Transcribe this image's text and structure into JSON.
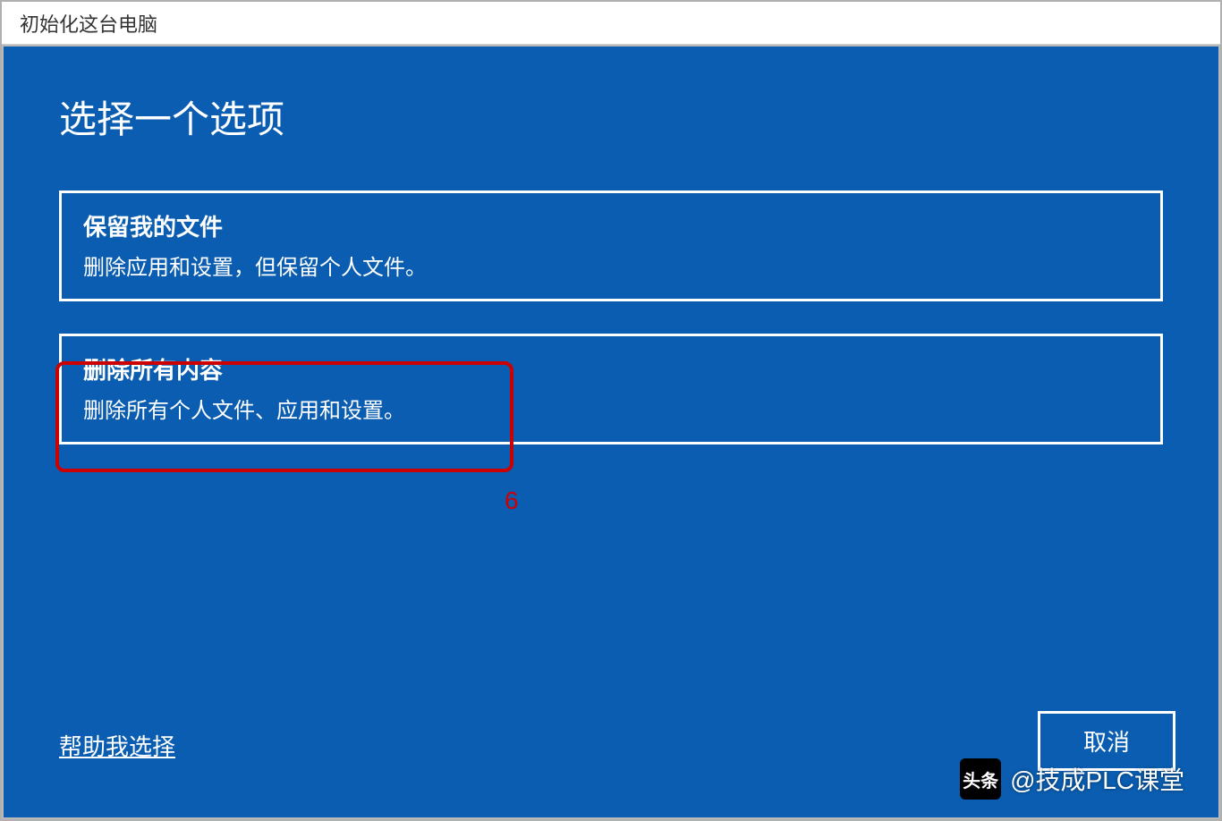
{
  "window": {
    "title": "初始化这台电脑"
  },
  "heading": "选择一个选项",
  "options": [
    {
      "title": "保留我的文件",
      "description": "删除应用和设置，但保留个人文件。"
    },
    {
      "title": "删除所有内容",
      "description": "删除所有个人文件、应用和设置。"
    }
  ],
  "annotation": {
    "number": "6"
  },
  "footer": {
    "help_link": "帮助我选择",
    "cancel_label": "取消"
  },
  "watermark": {
    "icon_text": "头条",
    "text": "@技成PLC课堂"
  }
}
